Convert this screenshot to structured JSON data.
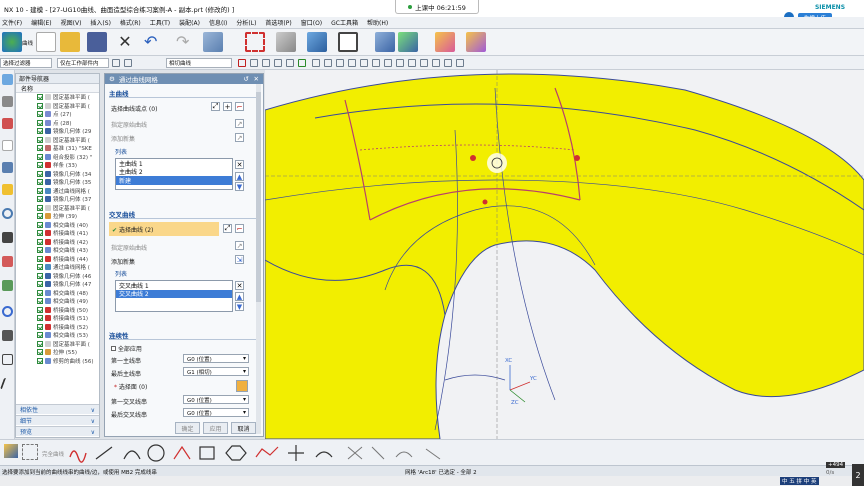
{
  "window": {
    "title": "NX 10 - 建模 - [27-UG10曲线、曲面造型综合练习案例-A - 副本.prt  (修改的) ]",
    "recording": "上课中 06:21:59",
    "brand": "SIEMENS",
    "upload_label": "拖拽上传"
  },
  "menu": [
    "文件(F)",
    "编辑(E)",
    "视图(V)",
    "插入(S)",
    "格式(R)",
    "工具(T)",
    "装配(A)",
    "信息(I)",
    "分析(L)",
    "首选项(P)",
    "窗口(O)",
    "GC工具箱",
    "帮助(H)"
  ],
  "ribbon": {
    "first_label": "曲线"
  },
  "selection": {
    "filter": "选择过滤器",
    "scope": "仅在工作部件内",
    "curve_rule": "相切曲线"
  },
  "navigator": {
    "title": "部件导航器",
    "column": "名称",
    "items": [
      "固定基准平面 (",
      "固定基准平面 (",
      "点 (27)",
      "点 (28)",
      "镜像几何体 (29",
      "固定基准平面 (",
      "基准 (31) \"SKE",
      "组合投影 (32) \"",
      "样条 (33)",
      "镜像几何体 (34",
      "镜像几何体 (35",
      "通过曲线网格 (",
      "镜像几何体 (37",
      "固定基准平面 (",
      "拉伸 (39)",
      "相交曲线 (40)",
      "桥接曲线 (41)",
      "桥接曲线 (42)",
      "相交曲线 (43)",
      "桥接曲线 (44)",
      "通过曲线网格 (",
      "镜像几何体 (46",
      "镜像几何体 (47",
      "相交曲线 (48)",
      "相交曲线 (49)",
      "桥接曲线 (50)",
      "桥接曲线 (51)",
      "桥接曲线 (52)",
      "相交曲线 (53)",
      "固定基准平面 (",
      "拉伸 (55)",
      "修剪的曲线 (56)"
    ],
    "footer": [
      "相依性",
      "细节",
      "预览"
    ]
  },
  "dialog": {
    "title": "通过曲线网格",
    "primary": {
      "section": "主曲线",
      "select_curve": "选择曲线或点 (0)",
      "pick_origin": "指定原始曲线",
      "add_set": "添加新集",
      "list_label": "列表",
      "list": [
        "主曲线 1",
        "主曲线 2",
        "新建"
      ]
    },
    "cross": {
      "section": "交叉曲线",
      "select_curve": "选择曲线 (2)",
      "pick_origin": "指定原始曲线",
      "add_set": "添加新集",
      "list_label": "列表",
      "list": [
        "交叉曲线 1",
        "交叉曲线 2"
      ]
    },
    "continuity": {
      "section": "连续性",
      "all_apply": "全部应用",
      "first_primary": "第一主线串",
      "first_primary_value": "G0 (位置)",
      "last_primary": "最后主线串",
      "last_primary_value": "G1 (相切)",
      "select_face": "选择面 (0)",
      "first_cross": "第一交叉线串",
      "first_cross_value": "G0 (位置)",
      "last_cross": "最后交叉线串",
      "last_cross_value": "G0 (位置)"
    },
    "buttons": {
      "ok": "确定",
      "apply": "应用",
      "cancel": "取消"
    }
  },
  "viewport": {
    "colors": {
      "surface": "#f2ee00",
      "edge": "#3a4a9a",
      "curve": "#b8406a"
    },
    "triad": [
      "XC",
      "YC",
      "ZC"
    ],
    "triad2": [
      "XC",
      "YC",
      "ZC"
    ]
  },
  "status": {
    "left": "选择要添加到当前的曲线线串的曲线/边，或使用 MB2 完成线串",
    "center": "网格 'Arc18' 已选定 - 全部 2"
  },
  "bottomtb": {
    "label": "完全曲线"
  },
  "taskbar": {
    "net": "+494",
    "rate": "0/s",
    "tray": "中 五 拼 中 英",
    "clock": "2"
  }
}
